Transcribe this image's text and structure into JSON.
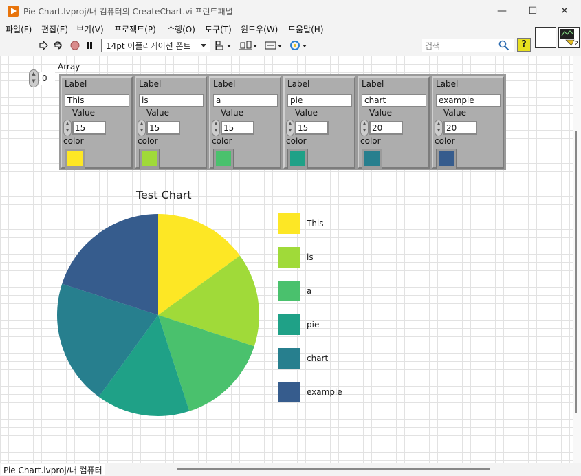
{
  "window": {
    "title": "Pie Chart.lvproj/내 컴퓨터의 CreateChart.vi 프런트패널",
    "minimize_glyph": "—",
    "maximize_glyph": "☐",
    "close_glyph": "✕"
  },
  "menu": [
    "파일(F)",
    "편집(E)",
    "보기(V)",
    "프로젝트(P)",
    "수행(O)",
    "도구(T)",
    "윈도우(W)",
    "도움말(H)"
  ],
  "toolbar": {
    "font_select": "14pt 어플리케이션 폰트",
    "search_placeholder": "검색",
    "help_glyph": "?",
    "icons": [
      "run-arrow-icon",
      "run-continuously-icon",
      "abort-icon",
      "pause-icon",
      "align-objects-icon",
      "distribute-objects-icon",
      "resize-objects-icon",
      "reorder-icon",
      "search-icon"
    ]
  },
  "vi_icon_badge": "2",
  "array": {
    "label": "Array",
    "index": "0",
    "element_label": "Label",
    "value_label": "Value",
    "color_label": "color",
    "elements": [
      {
        "label": "This",
        "value": "15",
        "color": "#fde725"
      },
      {
        "label": "is",
        "value": "15",
        "color": "#a0da39"
      },
      {
        "label": "a",
        "value": "15",
        "color": "#4ac16d"
      },
      {
        "label": "pie",
        "value": "15",
        "color": "#1fa187"
      },
      {
        "label": "chart",
        "value": "20",
        "color": "#277f8e"
      },
      {
        "label": "example",
        "value": "20",
        "color": "#365c8d"
      }
    ]
  },
  "chart_data": {
    "type": "pie",
    "title": "Test Chart",
    "categories": [
      "This",
      "is",
      "a",
      "pie",
      "chart",
      "example"
    ],
    "values": [
      15,
      15,
      15,
      15,
      20,
      20
    ],
    "colors": [
      "#fde725",
      "#a0da39",
      "#4ac16d",
      "#1fa187",
      "#277f8e",
      "#365c8d"
    ],
    "legend_position": "right"
  },
  "status": {
    "context": "Pie Chart.lvproj/내 컴퓨터"
  }
}
